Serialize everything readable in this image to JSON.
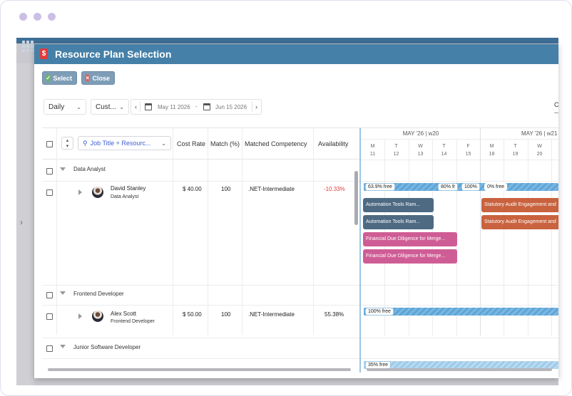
{
  "app": {
    "title": "Resource Plan Selection"
  },
  "toolbar": {
    "select_label": "Select",
    "close_label": "Close"
  },
  "filters": {
    "view_mode": "Daily",
    "range_mode": "Cust...",
    "start_date": "May 11 2026",
    "end_date": "Jun 15 2026",
    "separator": "-",
    "cut_text": "C"
  },
  "grid": {
    "group_by_label": "Job Title + Resourc...",
    "columns": {
      "cost_rate": "Cost Rate",
      "match": "Match (%)",
      "competency": "Matched Competency",
      "availability": "Availability"
    },
    "groups": [
      {
        "label": "Data Analyst",
        "people": [
          {
            "name": "David Stanley",
            "role": "Data Analyst",
            "cost_rate": "$ 40.00",
            "match": "100",
            "competency": ".NET-Intermediate",
            "availability": "-10.33%"
          }
        ]
      },
      {
        "label": "Frontend Developer",
        "people": [
          {
            "name": "Alex Scott",
            "role": "Frontend Developer",
            "cost_rate": "$ 50.00",
            "match": "100",
            "competency": ".NET-Intermediate",
            "availability": "55.38%"
          }
        ]
      },
      {
        "label": "Junior Software Developer",
        "people": []
      }
    ]
  },
  "gantt": {
    "weeks": [
      "MAY '26 | w20",
      "MAY '26 | w21"
    ],
    "days": [
      {
        "dow": "M",
        "num": "11"
      },
      {
        "dow": "T",
        "num": "12"
      },
      {
        "dow": "W",
        "num": "13"
      },
      {
        "dow": "T",
        "num": "14"
      },
      {
        "dow": "F",
        "num": "15"
      },
      {
        "dow": "M",
        "num": "18"
      },
      {
        "dow": "T",
        "num": "19"
      },
      {
        "dow": "W",
        "num": "20"
      }
    ],
    "availability_labels": {
      "david_1": "63.9% free",
      "david_2": "80% fr",
      "david_3": "100%",
      "david_4": "0% free",
      "alex_1": "100% free",
      "junior_1": "35% free"
    },
    "tasks": {
      "t1": "Automation Tools Ram...",
      "t2": "Automation Tools Ram...",
      "t3": "Financial Due Diligence for Merge...",
      "t4": "Financial Due Diligence for Merge...",
      "t5": "Statutory Audit Engagement and",
      "t6": "Statutory Audit Engagement and"
    }
  },
  "colors": {
    "header": "#4580a8",
    "task_slate": "#4d6a82",
    "task_orange": "#c9623e",
    "task_pink": "#cf5d95",
    "negative": "#e23a3a"
  }
}
